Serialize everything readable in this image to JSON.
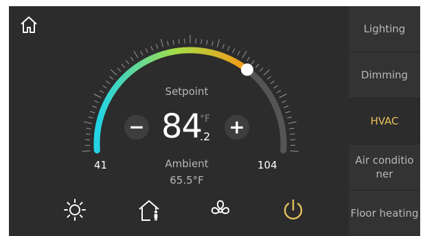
{
  "dial": {
    "setpoint_label": "Setpoint",
    "setpoint_integer": "84",
    "setpoint_unit": "°F",
    "setpoint_decimal": ".2",
    "ambient_label": "Ambient",
    "ambient_value": "65.5°F",
    "min_label": "41",
    "max_label": "104",
    "setpoint_fraction": 0.7
  },
  "controls": {
    "minus_label": "−",
    "plus_label": "+"
  },
  "bottom_bar": {
    "icons": [
      "brightness-icon",
      "home-person-icon",
      "fan-icon",
      "power-icon"
    ],
    "power_color": "#e8c25a"
  },
  "sidebar": {
    "items": [
      {
        "label": "Lighting",
        "active": false
      },
      {
        "label": "Dimming",
        "active": false
      },
      {
        "label": "HVAC",
        "active": true
      },
      {
        "label": "Air conditioner",
        "active": false
      },
      {
        "label": "Floor heating",
        "active": false
      }
    ]
  },
  "colors": {
    "background": "#2c2c2c",
    "accent": "#e8c25a",
    "arc_start": "#22d3e6",
    "arc_mid": "#a6dd46",
    "arc_end": "#f29c1a",
    "arc_track": "#555555"
  }
}
